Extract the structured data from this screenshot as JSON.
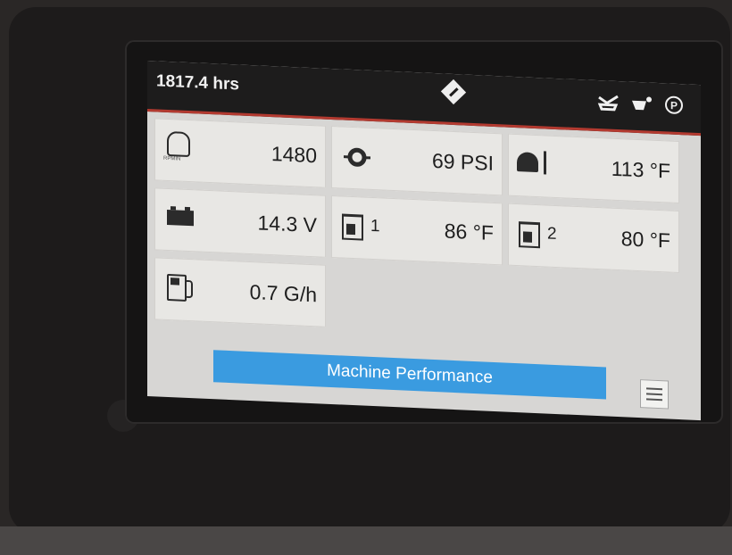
{
  "status_bar": {
    "engine_hours": "1817.4 hrs",
    "icons": [
      "warning-diamond-icon",
      "seat-belt-icon",
      "hydraulic-oil-icon",
      "parking-brake-icon"
    ],
    "parking_brake_label": "P"
  },
  "gauges": {
    "engine_speed": {
      "value": "1480",
      "icon": "engine-speed-icon",
      "icon_caption": "RPMIN"
    },
    "oil_pressure": {
      "value": "69 PSI",
      "icon": "oil-pressure-icon"
    },
    "coolant_temp": {
      "value": "113 °F",
      "icon": "coolant-temperature-icon"
    },
    "battery_voltage": {
      "value": "14.3 V",
      "icon": "battery-icon"
    },
    "tank1_temp": {
      "value": "86 °F",
      "index": "1",
      "icon": "hydraulic-tank-temp-icon"
    },
    "tank2_temp": {
      "value": "80 °F",
      "index": "2",
      "icon": "hydraulic-tank-temp-icon"
    },
    "fuel_rate": {
      "value": "0.7 G/h",
      "icon": "fuel-pump-icon"
    }
  },
  "footer": {
    "page_title": "Machine Performance",
    "menu_icon": "menu-icon"
  },
  "colors": {
    "accent": "#3a9be0",
    "status_bar": "#1d1c1c",
    "status_underline": "#b33a30",
    "tile": "#e8e7e4"
  }
}
